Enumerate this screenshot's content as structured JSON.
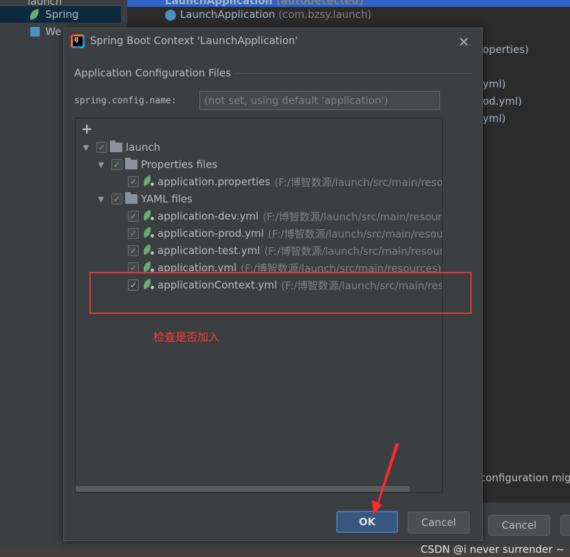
{
  "background": {
    "sidebar": [
      {
        "label": "launch"
      },
      {
        "label": "Spring",
        "selected": true
      },
      {
        "label": "We"
      }
    ],
    "editor_lines": [
      {
        "name": "LaunchApplication",
        "dim": "(autodetected)"
      },
      {
        "name": "LaunchApplication",
        "dim": "(com.bzsy.launch)"
      }
    ],
    "right_fragments": [
      "operties)",
      "yml)",
      "od.yml)",
      "yml)",
      "configuration mig"
    ],
    "cancel_label": "Cancel"
  },
  "dialog": {
    "title": "Spring Boot Context 'LaunchApplication'",
    "section_title": "Application Configuration Files",
    "config_name_label": "spring.config.name:",
    "config_name_placeholder": "(not set, using default 'application')",
    "add_symbol": "+",
    "tree": {
      "root": {
        "label": "launch"
      },
      "groups": [
        {
          "label": "Properties files",
          "files": [
            {
              "name": "application.properties",
              "path": "(F:/博智数源/launch/src/main/resou"
            }
          ]
        },
        {
          "label": "YAML files",
          "files": [
            {
              "name": "application-dev.yml",
              "path": "(F:/博智数源/launch/src/main/resourc"
            },
            {
              "name": "application-prod.yml",
              "path": "(F:/博智数源/launch/src/main/resour"
            },
            {
              "name": "application-test.yml",
              "path": "(F:/博智数源/launch/src/main/resourc"
            },
            {
              "name": "application.yml",
              "path": "(F:/博智数源/launch/src/main/resources)"
            },
            {
              "name": "applicationContext.yml",
              "path": "(F:/博智数源/launch/src/main/reso"
            }
          ]
        }
      ]
    },
    "ok_label": "OK",
    "cancel_label": "Cancel"
  },
  "annotation": {
    "text": "检查是否加入",
    "color": "#ff3b30"
  },
  "watermark": "CSDN @i never surrender ~"
}
